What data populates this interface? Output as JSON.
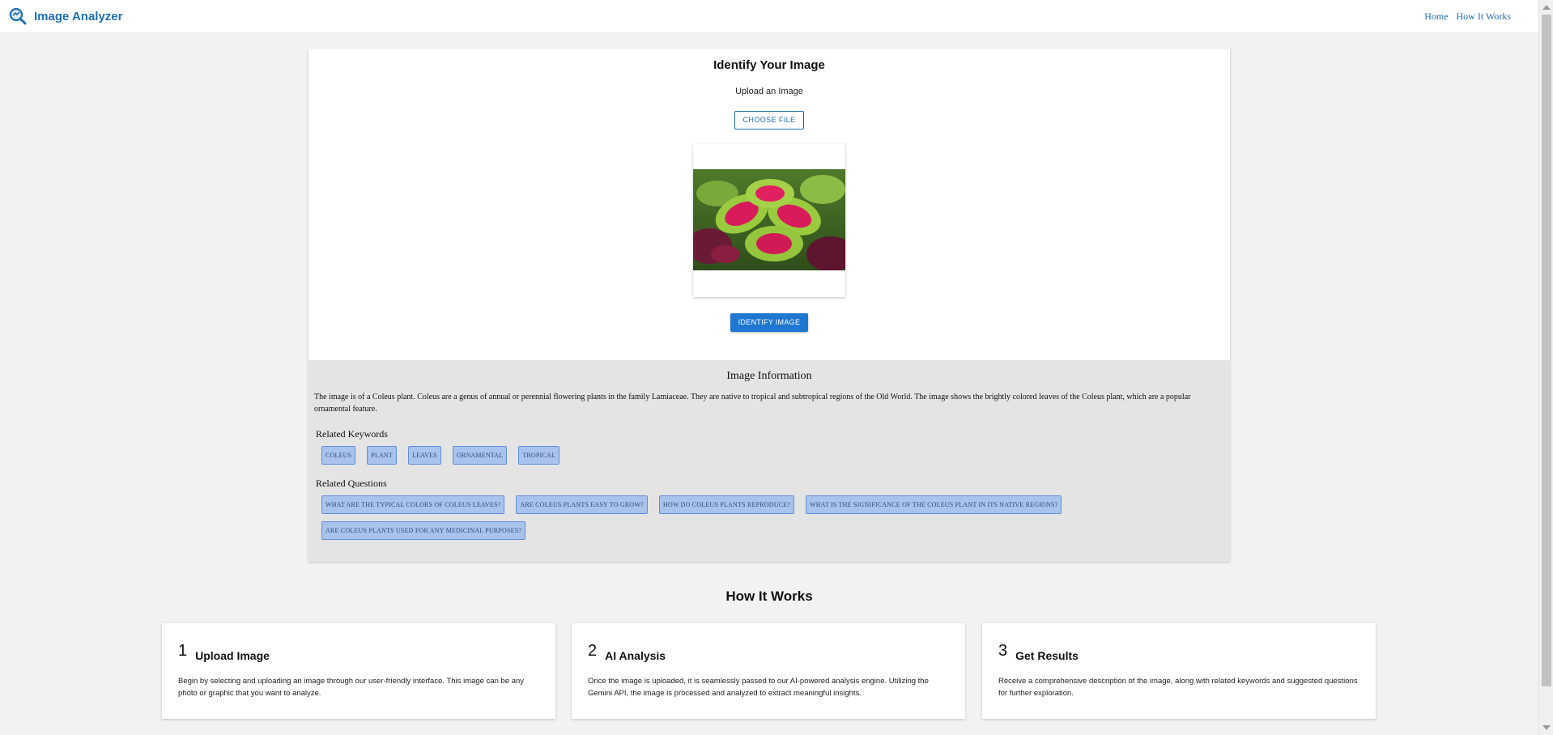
{
  "header": {
    "app_name": "Image Analyzer",
    "logo_icon": "magnifier-analyzer-icon",
    "nav": [
      {
        "label": "Home"
      },
      {
        "label": "How It Works"
      }
    ]
  },
  "upload": {
    "title": "Identify Your Image",
    "label": "Upload an Image",
    "choose_button": "CHOOSE FILE",
    "identify_button": "IDENTIFY IMAGE"
  },
  "info": {
    "title": "Image Information",
    "description": "The image is of a Coleus plant. Coleus are a genus of annual or perennial flowering plants in the family Lamiaceae. They are native to tropical and subtropical regions of the Old World. The image shows the brightly colored leaves of the Coleus plant, which are a popular ornamental feature.",
    "keywords_heading": "Related Keywords",
    "keywords": [
      "COLEUS",
      "PLANT",
      "LEAVES",
      "ORNAMENTAL",
      "TROPICAL"
    ],
    "questions_heading": "Related Questions",
    "questions": [
      "WHAT ARE THE TYPICAL COLORS OF COLEUS LEAVES?",
      "ARE COLEUS PLANTS EASY TO GROW?",
      "HOW DO COLEUS PLANTS REPRODUCE?",
      "WHAT IS THE SIGNIFICANCE OF THE COLEUS PLANT IN ITS NATIVE REGIONS?",
      "ARE COLEUS PLANTS USED FOR ANY MEDICINAL PURPOSES?"
    ]
  },
  "how_it_works": {
    "title": "How It Works",
    "steps": [
      {
        "num": "1",
        "title": "Upload Image",
        "text": "Begin by selecting and uploading an image through our user-friendly interface. This image can be any photo or graphic that you want to analyze."
      },
      {
        "num": "2",
        "title": "AI Analysis",
        "text": "Once the image is uploaded, it is seamlessly passed to our AI-powered analysis engine. Utilizing the Gemini API, the image is processed and analyzed to extract meaningful insights."
      },
      {
        "num": "3",
        "title": "Get Results",
        "text": "Receive a comprehensive description of the image, along with related keywords and suggested questions for further exploration."
      }
    ]
  },
  "colors": {
    "accent": "#1f6fb2",
    "button_primary": "#1f77d0",
    "chip_bg": "#a9c3ec",
    "info_bg": "#e4e4e4"
  }
}
